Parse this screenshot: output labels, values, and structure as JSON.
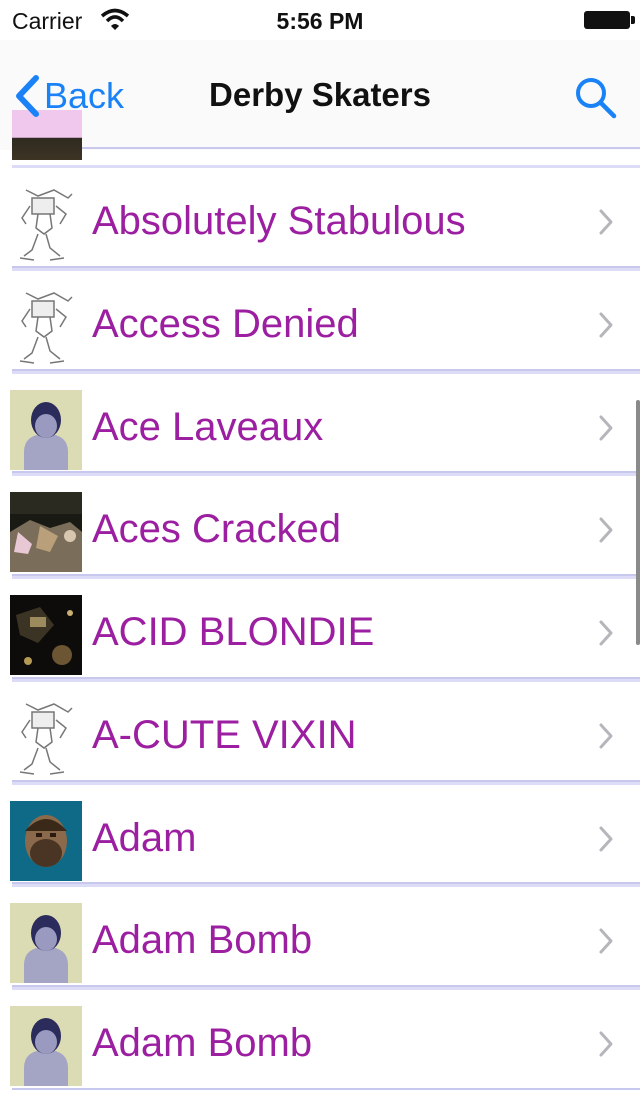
{
  "status_bar": {
    "carrier": "Carrier",
    "time": "5:56 PM"
  },
  "nav": {
    "back_label": "Back",
    "title": "Derby Skaters"
  },
  "skaters": [
    {
      "name": "Absolutely Stabulous",
      "avatar": "robot-sketch-icon"
    },
    {
      "name": "Access Denied",
      "avatar": "robot-sketch-icon"
    },
    {
      "name": "Ace Laveaux",
      "avatar": "default-person-icon"
    },
    {
      "name": "Aces Cracked",
      "avatar": "skater-photo"
    },
    {
      "name": "ACID BLONDIE",
      "avatar": "dark-photo"
    },
    {
      "name": "A-CUTE VIXIN",
      "avatar": "robot-sketch-icon"
    },
    {
      "name": "Adam",
      "avatar": "face-photo"
    },
    {
      "name": "Adam Bomb",
      "avatar": "default-person-icon"
    },
    {
      "name": "Adam Bomb",
      "avatar": "default-person-icon"
    }
  ],
  "colors": {
    "accent": "#1a82f7",
    "skater_name": "#9b1fa0",
    "separator": "#c8c8ee",
    "avatar_bg": "#dcdcb4",
    "person_head": "#2c2c5c",
    "person_body": "#a4a4c4"
  }
}
